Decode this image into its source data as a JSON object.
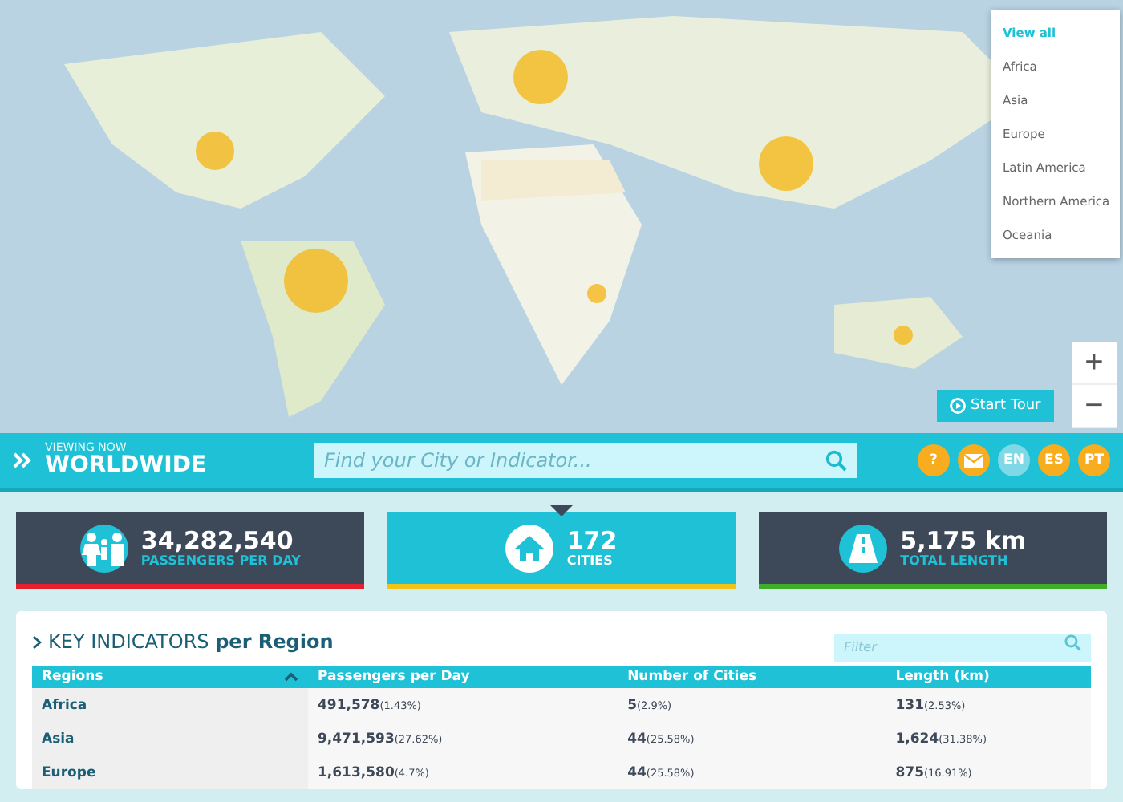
{
  "map": {
    "region_menu": [
      {
        "label": "View all",
        "selected": true
      },
      {
        "label": "Africa",
        "selected": false
      },
      {
        "label": "Asia",
        "selected": false
      },
      {
        "label": "Europe",
        "selected": false
      },
      {
        "label": "Latin America",
        "selected": false
      },
      {
        "label": "Northern America",
        "selected": false
      },
      {
        "label": "Oceania",
        "selected": false
      }
    ],
    "zoom_in": "+",
    "zoom_out": "−",
    "tour_button": "Start Tour"
  },
  "header": {
    "caption": "VIEWING NOW",
    "scope": "WORLDWIDE",
    "search": {
      "placeholder": "Find your City or Indicator..."
    },
    "help": "?",
    "languages": [
      {
        "label": "EN",
        "selected": true
      },
      {
        "label": "ES",
        "selected": false
      },
      {
        "label": "PT",
        "selected": false
      }
    ]
  },
  "stats": [
    {
      "kind": "people",
      "value": "34,282,540",
      "label": "PASSENGERS PER DAY",
      "selected": false,
      "color": "#e8202e"
    },
    {
      "kind": "city",
      "value": "172",
      "label": "CITIES",
      "selected": true,
      "color": "#f2c318"
    },
    {
      "kind": "road",
      "value": "5,175 km",
      "label": "TOTAL LENGTH",
      "selected": false,
      "color": "#3fae2a"
    }
  ],
  "indicators": {
    "title": "KEY INDICATORS",
    "title_suffix": "per Region",
    "filter": {
      "placeholder": "Filter"
    },
    "columns": [
      {
        "label": "Regions",
        "sorted": true
      },
      {
        "label": "Passengers per Day",
        "sorted": false
      },
      {
        "label": "Number of Cities",
        "sorted": false
      },
      {
        "label": "Length (km)",
        "sorted": false
      }
    ],
    "rows": [
      [
        {
          "value": "Africa"
        },
        {
          "value": "491,578",
          "share": "(1.43%)"
        },
        {
          "value": "5",
          "share": "(2.9%)"
        },
        {
          "value": "131",
          "share": "(2.53%)"
        }
      ],
      [
        {
          "value": "Asia"
        },
        {
          "value": "9,471,593",
          "share": "(27.62%)"
        },
        {
          "value": "44",
          "share": "(25.58%)"
        },
        {
          "value": "1,624",
          "share": "(31.38%)"
        }
      ],
      [
        {
          "value": "Europe"
        },
        {
          "value": "1,613,580",
          "share": "(4.7%)"
        },
        {
          "value": "44",
          "share": "(25.58%)"
        },
        {
          "value": "875",
          "share": "(16.91%)"
        }
      ]
    ]
  }
}
